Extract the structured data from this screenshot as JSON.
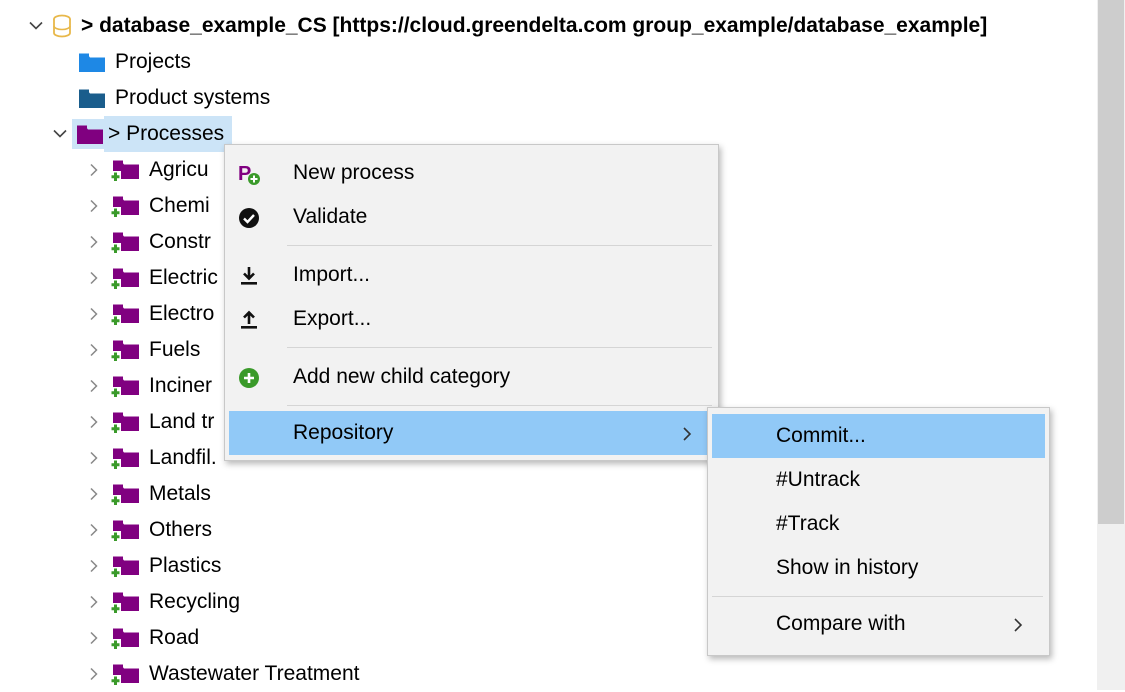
{
  "tree": {
    "root": {
      "label": "> database_example_CS [https://cloud.greendelta.com group_example/database_example]"
    },
    "projects": "Projects",
    "product_systems": "Product systems",
    "processes": "> Processes",
    "categories": [
      "Agricu",
      "Chemi",
      "Constr",
      "Electric",
      "Electro",
      "Fuels",
      "Inciner",
      "Land tr",
      "Landfil.",
      "Metals",
      "Others",
      "Plastics",
      "Recycling",
      "Road",
      "Wastewater Treatment"
    ]
  },
  "context_menu": {
    "new_process": "New process",
    "validate": "Validate",
    "import": "Import...",
    "export": "Export...",
    "add_child_category": "Add new child category",
    "repository": "Repository"
  },
  "repository_submenu": {
    "commit": "Commit...",
    "untrack": "#Untrack",
    "track": "#Track",
    "show_in_history": "Show in history",
    "compare_with": "Compare with"
  },
  "colors": {
    "process_folder": "#800080",
    "projects_folder": "#1e88e5",
    "product_systems_folder": "#1a5d8c",
    "plus_green": "#3a9a2a",
    "selection": "#cce4f7",
    "menu_hover": "#91c9f7",
    "database_icon": "#e8b84a"
  }
}
